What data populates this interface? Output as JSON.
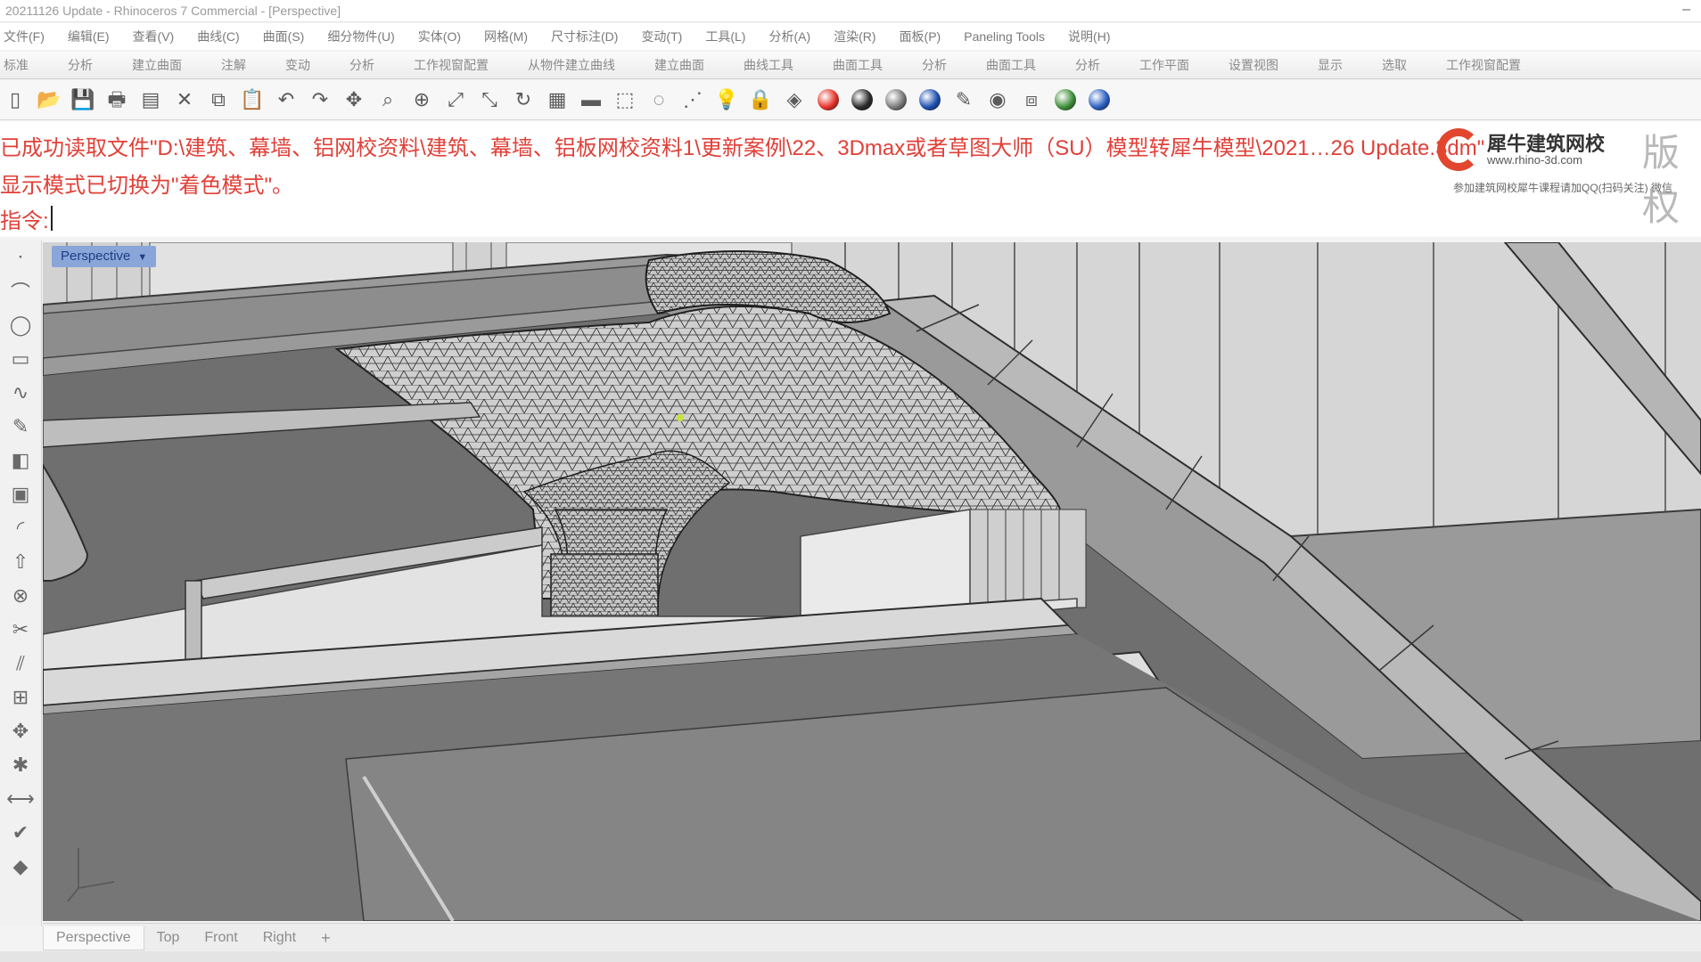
{
  "window": {
    "title": "20211126 Update - Rhinoceros 7 Commercial - [Perspective]"
  },
  "menubar": [
    "文件(F)",
    "编辑(E)",
    "查看(V)",
    "曲线(C)",
    "曲面(S)",
    "细分物件(U)",
    "实体(O)",
    "网格(M)",
    "尺寸标注(D)",
    "变动(T)",
    "工具(L)",
    "分析(A)",
    "渲染(R)",
    "面板(P)",
    "Paneling Tools",
    "说明(H)"
  ],
  "toolbar_tabs": [
    "标准",
    "分析",
    "建立曲面",
    "注解",
    "变动",
    "分析",
    "工作视窗配置",
    "从物件建立曲线",
    "建立曲面",
    "曲线工具",
    "曲面工具",
    "分析",
    "曲面工具",
    "分析",
    "工作平面",
    "设置视图",
    "显示",
    "选取",
    "工作视窗配置"
  ],
  "toolbar_icons": [
    {
      "name": "new-file-icon",
      "glyph": "▯"
    },
    {
      "name": "open-folder-icon",
      "glyph": "📂"
    },
    {
      "name": "save-icon",
      "glyph": "💾"
    },
    {
      "name": "print-icon",
      "glyph": "🖶"
    },
    {
      "name": "import-icon",
      "glyph": "▤"
    },
    {
      "name": "cut-icon",
      "glyph": "✕"
    },
    {
      "name": "copy-icon",
      "glyph": "⧉"
    },
    {
      "name": "paste-icon",
      "glyph": "📋"
    },
    {
      "name": "undo-icon",
      "glyph": "↶"
    },
    {
      "name": "redo-icon",
      "glyph": "↷"
    },
    {
      "name": "pan-icon",
      "glyph": "✥"
    },
    {
      "name": "zoom-icon",
      "glyph": "⌕"
    },
    {
      "name": "zoom-window-icon",
      "glyph": "⊕"
    },
    {
      "name": "zoom-extents-icon",
      "glyph": "⤢"
    },
    {
      "name": "zoom-selected-icon",
      "glyph": "⤡"
    },
    {
      "name": "rotate-view-icon",
      "glyph": "↻"
    },
    {
      "name": "grid-icon",
      "glyph": "▦"
    },
    {
      "name": "plane-icon",
      "glyph": "▬"
    },
    {
      "name": "select-icon",
      "glyph": "⬚"
    },
    {
      "name": "lasso-icon",
      "glyph": "◌"
    },
    {
      "name": "snap-icon",
      "glyph": "⋰"
    },
    {
      "name": "light-icon",
      "glyph": "💡"
    },
    {
      "name": "lock-icon",
      "glyph": "🔒"
    },
    {
      "name": "layer-icon",
      "glyph": "◈"
    },
    {
      "name": "color-wheel-icon",
      "glyph": "ball",
      "color": "#e6332a"
    },
    {
      "name": "render-sphere-icon",
      "glyph": "ball",
      "color": "#2b2b2b"
    },
    {
      "name": "material-sphere-icon",
      "glyph": "ball",
      "color": "#7a7a7a"
    },
    {
      "name": "environment-sphere-icon",
      "glyph": "ball",
      "color": "#1d4fb0"
    },
    {
      "name": "highlight-icon",
      "glyph": "✎"
    },
    {
      "name": "render-icon",
      "glyph": "◉"
    },
    {
      "name": "viewport-layout-icon",
      "glyph": "⧈"
    },
    {
      "name": "globe-icon",
      "glyph": "ball",
      "color": "#3f8f3a"
    },
    {
      "name": "help-icon",
      "glyph": "ball",
      "color": "#2c5fc2"
    }
  ],
  "command": {
    "history": [
      "已成功读取文件\"D:\\建筑、幕墙、铝网校资料\\建筑、幕墙、铝板网校资料1\\更新案例\\22、3Dmax或者草图大师（SU）模型转犀牛模型\\2021…26 Update.3dm\"",
      "显示模式已切换为\"着色模式\"。"
    ],
    "prompt": "指令:"
  },
  "watermark": {
    "brand": "犀牛建筑网校",
    "url": "www.rhino-3d.com",
    "side_text": "版权",
    "tagline": "参加建筑网校犀牛课程请加QQ(扫码关注)  微信"
  },
  "left_toolbar": [
    "point-icon",
    "polyline-icon",
    "circle-icon",
    "rectangle-icon",
    "curve-icon",
    "freeform-icon",
    "surface-icon",
    "box-solid-icon",
    "fillet-icon",
    "extrude-icon",
    "boolean-icon",
    "trim-icon",
    "split-icon",
    "join-icon",
    "move-icon",
    "explode-icon",
    "dimension-icon",
    "check-icon",
    "shaded-icon"
  ],
  "viewport": {
    "label": "Perspective",
    "arrow": "▼",
    "axis_icon": "world-axis-icon"
  },
  "view_tabs": [
    "Perspective",
    "Top",
    "Front",
    "Right",
    "+"
  ],
  "colors": {
    "history_text": "#e04038",
    "viewport_label_bg": "#8aa6d9",
    "viewport_bg": "#8c8c8c"
  }
}
